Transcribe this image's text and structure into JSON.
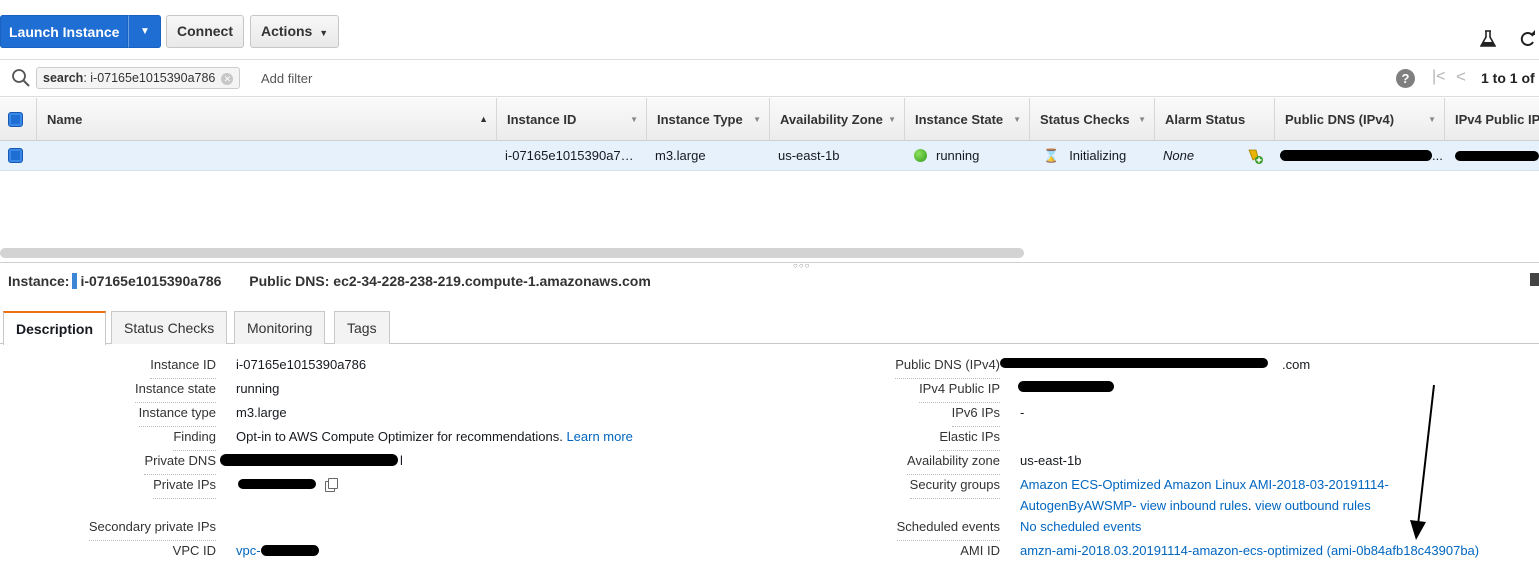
{
  "toolbar": {
    "launch_label": "Launch Instance",
    "connect_label": "Connect",
    "actions_label": "Actions"
  },
  "search": {
    "token_key": "search",
    "token_value": ": i-07165e1015390a786",
    "placeholder": "Add filter",
    "pager_text": "1 to 1 of"
  },
  "grid": {
    "columns": [
      "Name",
      "Instance ID",
      "Instance Type",
      "Availability Zone",
      "Instance State",
      "Status Checks",
      "Alarm Status",
      "Public DNS (IPv4)",
      "IPv4 Public IP"
    ],
    "row": {
      "name": "",
      "instance_id": "i-07165e1015390a7…",
      "instance_type": "m3.large",
      "availability_zone": "us-east-1b",
      "instance_state": "running",
      "status_checks": "Initializing",
      "alarm_status": "None",
      "public_dns_suffix": "..."
    }
  },
  "detail": {
    "instance_label": "Instance:",
    "instance_id": "i-07165e1015390a786",
    "public_dns_label": "Public DNS:",
    "public_dns": "ec2-34-228-238-219.compute-1.amazonaws.com",
    "tabs": [
      "Description",
      "Status Checks",
      "Monitoring",
      "Tags"
    ],
    "left": {
      "instance_id_label": "Instance ID",
      "instance_id": "i-07165e1015390a786",
      "instance_state_label": "Instance state",
      "instance_state": "running",
      "instance_type_label": "Instance type",
      "instance_type": "m3.large",
      "finding_label": "Finding",
      "finding": "Opt-in to AWS Compute Optimizer for recommendations.",
      "finding_link": "Learn more",
      "private_dns_label": "Private DNS",
      "private_dns_tail": "l",
      "private_ips_label": "Private IPs",
      "secondary_ips_label": "Secondary private IPs",
      "vpc_id_label": "VPC ID",
      "vpc_id_prefix": "vpc-"
    },
    "right": {
      "public_dns_label": "Public DNS (IPv4)",
      "public_dns_tail": ".com",
      "ipv4_label": "IPv4 Public IP",
      "ipv6_label": "IPv6 IPs",
      "ipv6": "-",
      "elastic_label": "Elastic IPs",
      "az_label": "Availability zone",
      "az": "us-east-1b",
      "sg_label": "Security groups",
      "sg_line1": "Amazon ECS-Optimized Amazon Linux AMI-2018-03-20191114-",
      "sg_line2_group": "AutogenByAWSMP-",
      "sg_inbound": "view inbound rules",
      "sg_outbound": "view outbound rules",
      "scheduled_label": "Scheduled events",
      "scheduled": "No scheduled events",
      "ami_label": "AMI ID",
      "ami": "amzn-ami-2018.03.20191114-amazon-ecs-optimized (ami-0b84afb18c43907ba)"
    }
  },
  "colors": {
    "primary": "#1f6ed4",
    "link": "#0066c0",
    "active_tab": "#ec7211",
    "selected_row": "#e6f1fc"
  }
}
